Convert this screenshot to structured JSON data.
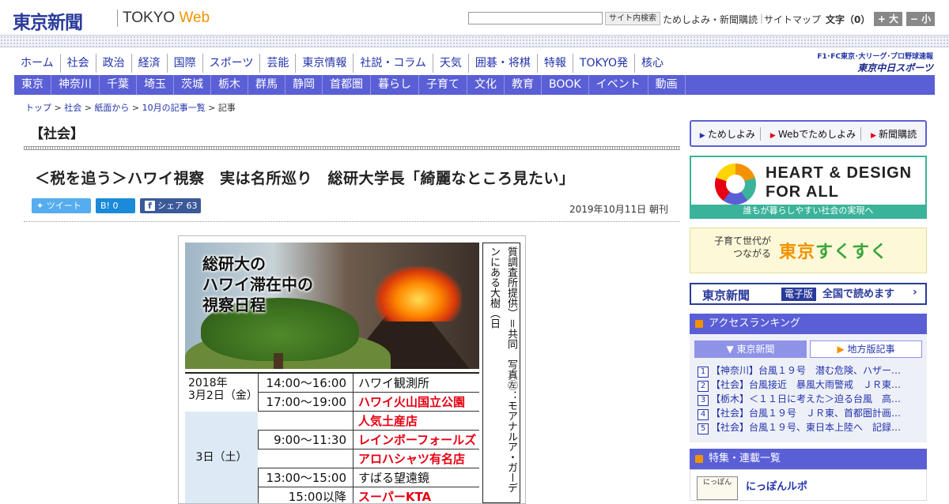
{
  "header": {
    "logo": "東京新聞",
    "logo_sub_a": "TOKYO ",
    "logo_sub_b": "Web",
    "search_button": "サイト内検索",
    "links": [
      "ためしよみ・新聞購読",
      "サイトマップ"
    ],
    "font_label": "文字（0）",
    "font_plus": "+ 大",
    "font_minus": "− 小"
  },
  "main_nav": [
    "ホーム",
    "社会",
    "政治",
    "経済",
    "国際",
    "スポーツ",
    "芸能",
    "東京情報",
    "社説・コラム",
    "天気",
    "囲碁・将棋",
    "特報",
    "TOKYO発",
    "核心"
  ],
  "chunichi": {
    "line1": "F1･FC東京･大リーグ･プロ野球速報",
    "line2": "東京中日スポーツ"
  },
  "sub_nav": [
    "東京",
    "神奈川",
    "千葉",
    "埼玉",
    "茨城",
    "栃木",
    "群馬",
    "静岡",
    "首都圏",
    "暮らし",
    "子育て",
    "文化",
    "教育",
    "BOOK",
    "イベント",
    "動画"
  ],
  "breadcrumb": {
    "items": [
      "トップ",
      "社会",
      "紙面から",
      "10月の記事一覧"
    ],
    "current": "記事"
  },
  "section_title": "【社会】",
  "article": {
    "headline": "＜税を追う＞ハワイ視察　実は名所巡り　総研大学長「綺麗なところ見たい」",
    "date": "2019年10月11日 朝刊",
    "tweet_label": "ツイート",
    "hatena_label": "B! 0",
    "share_label": "シェア 63"
  },
  "figure": {
    "photo_title": "総研大の\nハワイ滞在中の\n視察日程",
    "caption": "写真㊨：ハワイ火山国立公園のキラウエア火山（米地質調査所提供）＝共同　写真㊧：モアナルア・ガーデンにある大樹（日",
    "schedule": [
      {
        "day": "2018年\n3月2日（金）",
        "time": "14:00〜16:00",
        "activity": "ハワイ観測所",
        "highlight": false
      },
      {
        "day": "",
        "time": "17:00〜19:00",
        "activity": "ハワイ火山国立公園",
        "highlight": true
      },
      {
        "day": "",
        "time": "",
        "activity": "人気土産店",
        "highlight": true
      },
      {
        "day": "3日（土）",
        "time": "9:00〜11:30",
        "activity": "レインボーフォールズ",
        "highlight": true
      },
      {
        "day": "",
        "time": "",
        "activity": "アロハシャツ有名店",
        "highlight": true
      },
      {
        "day": "",
        "time": "13:00〜15:00",
        "activity": "すばる望遠鏡",
        "highlight": false
      },
      {
        "day": "",
        "time": "15:00以降",
        "activity": "スーパーKTA",
        "highlight": true
      }
    ]
  },
  "sidebar": {
    "promo": [
      {
        "label": "ためしよみ"
      },
      {
        "label": "Webでためしよみ"
      },
      {
        "label": "新聞購読"
      }
    ],
    "heart_design": {
      "title": "HEART & DESIGN\nFOR ALL",
      "subtitle": "誰もが暮らしやすい社会の実現へ"
    },
    "sukusuku": {
      "left": "子育て世代が\n　　つながる",
      "title_a": "東京",
      "title_b": "すくすく"
    },
    "e_paper": {
      "logo": "東京新聞",
      "tag": "電子版",
      "text": "全国で読めます",
      "arrow": "›"
    },
    "ranking": {
      "title": "アクセスランキング",
      "tab_a": "東京新聞",
      "tab_b": "地方版記事",
      "items": [
        {
          "num": "1",
          "text": "【神奈川】台風１９号　潜む危険、ハザー…"
        },
        {
          "num": "2",
          "text": "【社会】台風接近　暴風大雨警戒　ＪＲ東…"
        },
        {
          "num": "3",
          "text": "【栃木】＜１１日に考えた＞迫る台風　高…"
        },
        {
          "num": "4",
          "text": "【社会】台風１９号　ＪＲ東、首都圏計画…"
        },
        {
          "num": "5",
          "text": "【社会】台風１９号、東日本上陸へ　記録…"
        }
      ]
    },
    "features": {
      "title": "特集・連載一覧",
      "icon_text": "にっぽん",
      "item": "にっぽんルポ"
    }
  },
  "colors": {
    "nav_blue": "#5a5fd6",
    "brand_blue": "#2a3a9a",
    "accent_orange": "#f39200",
    "highlight_red": "#e60012"
  }
}
